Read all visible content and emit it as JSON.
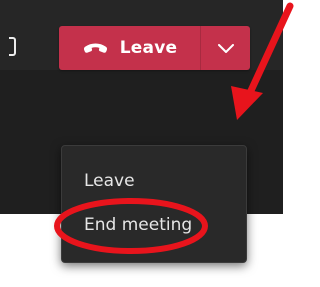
{
  "toolbar": {
    "leave_button_label": "Leave",
    "leave_icon": "phone-hangup-icon",
    "menu_toggle_icon": "chevron-down-icon"
  },
  "menu": {
    "items": [
      {
        "label": "Leave"
      },
      {
        "label": "End meeting"
      }
    ]
  },
  "annotation": {
    "color": "#e8141c",
    "highlighted_item": "End meeting"
  },
  "colors": {
    "leave_red": "#c4314b",
    "panel_dark": "#262626",
    "menu_bg": "#292929",
    "menu_text": "#e6e6e6"
  }
}
